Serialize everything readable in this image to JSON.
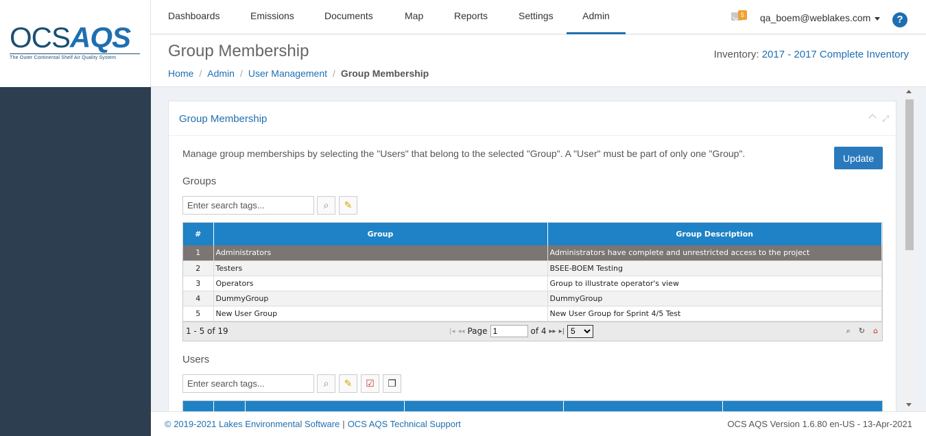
{
  "logo": {
    "part1": "OCS",
    "part2": "AQS",
    "tagline": "The Outer Continental Shelf Air Quality System"
  },
  "nav": {
    "items": [
      "Dashboards",
      "Emissions",
      "Documents",
      "Map",
      "Reports",
      "Settings",
      "Admin"
    ],
    "active": "Admin",
    "mail_count": "5",
    "user": "qa_boem@weblakes.com",
    "help": "?"
  },
  "page": {
    "title": "Group Membership",
    "breadcrumb": [
      "Home",
      "Admin",
      "User Management",
      "Group Membership"
    ],
    "inventory_label": "Inventory:",
    "inventory_value": "2017 - 2017 Complete Inventory"
  },
  "portlet": {
    "title": "Group Membership",
    "description": "Manage group memberships by selecting the \"Users\" that belong to the selected \"Group\". A \"User\" must be part of only one \"Group\".",
    "update_label": "Update",
    "groups_title": "Groups",
    "users_title": "Users",
    "search_placeholder": "Enter search tags..."
  },
  "groups_grid": {
    "columns": [
      "#",
      "Group",
      "Group Description"
    ],
    "rows": [
      {
        "num": "1",
        "group": "Administrators",
        "description": "Administrators have complete and unrestricted access to the project",
        "selected": true
      },
      {
        "num": "2",
        "group": "Testers",
        "description": "BSEE-BOEM Testing"
      },
      {
        "num": "3",
        "group": "Operators",
        "description": "Group to illustrate operator's view"
      },
      {
        "num": "4",
        "group": "DummyGroup",
        "description": "DummyGroup"
      },
      {
        "num": "5",
        "group": "New User Group",
        "description": "New User Group for Sprint 4/5 Test"
      }
    ],
    "pager": {
      "count": "1 - 5 of 19",
      "page_label": "Page",
      "page_value": "1",
      "of_label": "of 4",
      "page_size": "5"
    }
  },
  "footer": {
    "copyright": "© 2019-2021 Lakes Environmental Software",
    "support": "OCS AQS Technical Support",
    "version": "OCS AQS Version 1.6.80 en-US - 13-Apr-2021"
  }
}
